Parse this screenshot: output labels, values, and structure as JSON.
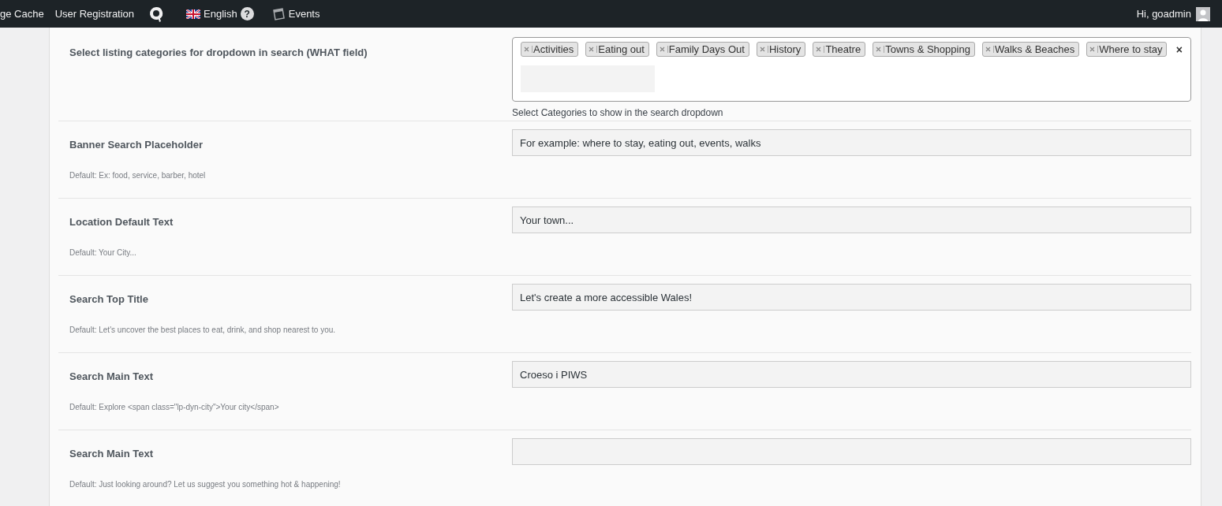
{
  "admin_bar": {
    "items": [
      {
        "kind": "text",
        "label": "ge Cache"
      },
      {
        "kind": "text",
        "label": "User Registration"
      },
      {
        "kind": "logo"
      },
      {
        "kind": "language",
        "label": "English",
        "help": "?"
      },
      {
        "kind": "events",
        "label": "Events"
      }
    ],
    "greeting": "Hi, goadmin"
  },
  "category_setting": {
    "label": "Select listing categories for dropdown in search (WHAT field)",
    "tags": [
      "Activities",
      "Eating out",
      "Family Days Out",
      "History",
      "Theatre",
      "Towns & Shopping",
      "Walks & Beaches",
      "Where to stay"
    ],
    "clear": "×",
    "help": "Select Categories to show in the search dropdown"
  },
  "settings": [
    {
      "label": "Banner Search Placeholder",
      "value": "For example: where to stay, eating out, events, walks",
      "default": "Default: Ex: food, service, barber, hotel"
    },
    {
      "label": "Location Default Text",
      "value": "Your town...",
      "default": "Default: Your City..."
    },
    {
      "label": "Search Top Title",
      "value": "Let's create a more accessible Wales!",
      "default": "Default: Let's uncover the best places to eat, drink, and shop nearest to you."
    },
    {
      "label": "Search Main Text",
      "value": "Croeso i PIWS",
      "default": "Default: Explore <span class=\"lp-dyn-city\">Your city</span>"
    },
    {
      "label": "Search Main Text",
      "default": "Default: Just looking around? Let us suggest you something hot & happening!"
    }
  ]
}
